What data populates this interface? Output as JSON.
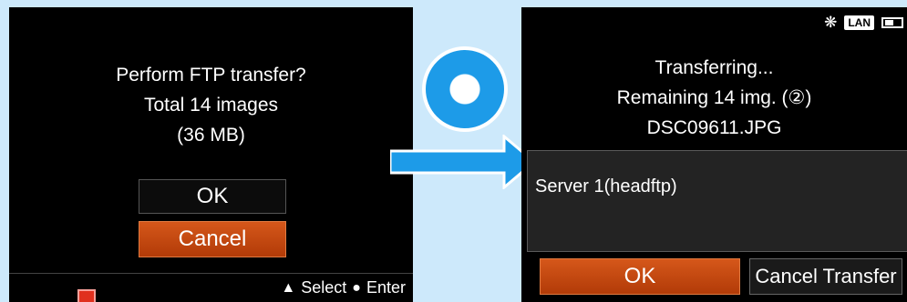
{
  "left": {
    "prompt_lines": [
      "Perform FTP transfer?",
      "Total 14 images",
      "(36 MB)"
    ],
    "ok_label": "OK",
    "cancel_label": "Cancel",
    "footer": {
      "select_label": "Select",
      "enter_label": "Enter"
    }
  },
  "right": {
    "status": {
      "lan_label": "LAN"
    },
    "progress_lines": [
      "Transferring...",
      "Remaining 14 img. (②)",
      "DSC09611.JPG"
    ],
    "server_label": "Server 1(headftp)",
    "ok_label": "OK",
    "cancel_label": "Cancel Transfer"
  },
  "icons": {
    "ok_mark": "circle-ok-icon",
    "arrow": "arrow-right-icon"
  },
  "colors": {
    "background": "#cde9fb",
    "accent_blue": "#1d9be8",
    "selected_orange": "#c8490f"
  }
}
